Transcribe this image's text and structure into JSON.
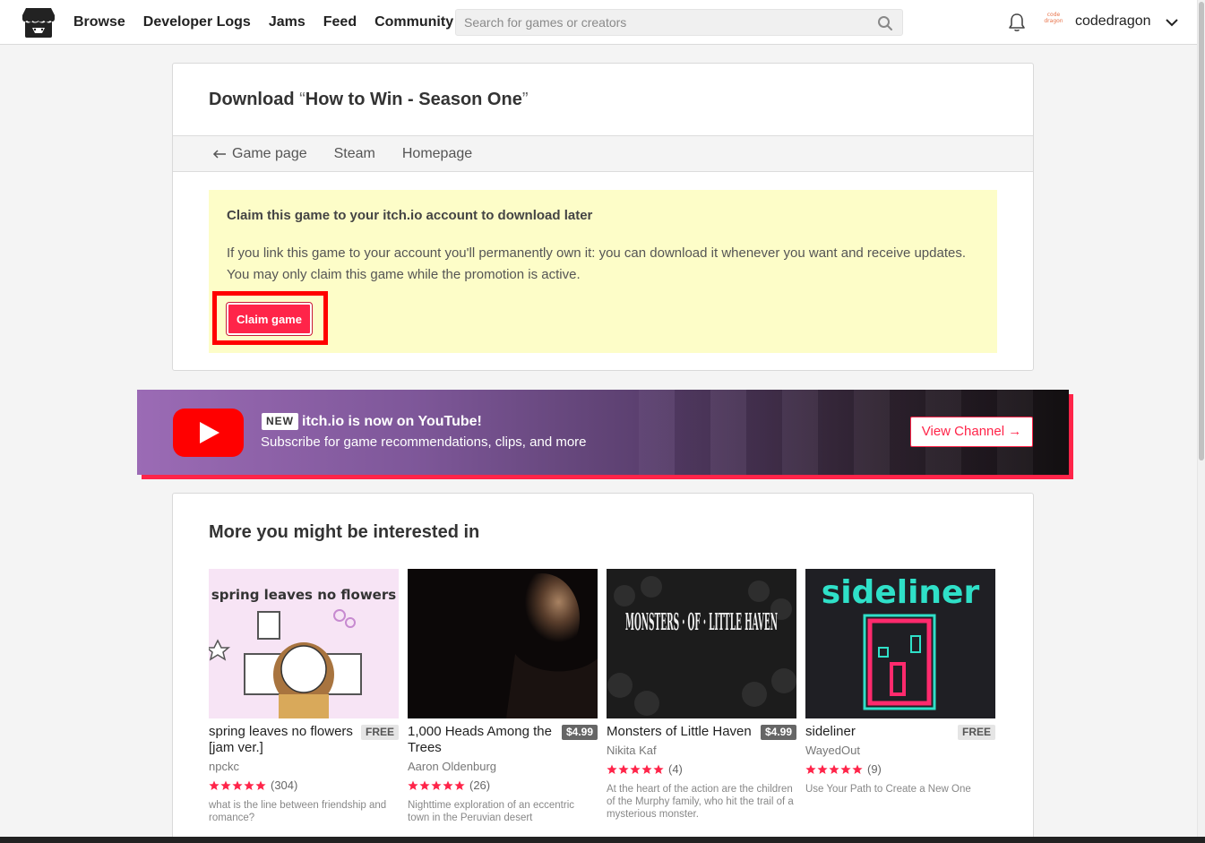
{
  "header": {
    "nav": [
      "Browse",
      "Developer Logs",
      "Jams",
      "Feed",
      "Community"
    ],
    "search_placeholder": "Search for games or creators",
    "username": "codedragon",
    "avatar_text": "code dragon"
  },
  "download": {
    "title_prefix": "Download ",
    "open_quote": "“",
    "game_title": "How to Win - Season One",
    "close_quote": "”",
    "subnav": [
      "Game page",
      "Steam",
      "Homepage"
    ],
    "claim_heading": "Claim this game to your itch.io account to download later",
    "claim_text": "If you link this game to your account you'll permanently own it: you can download it whenever you want and receive updates. You may only claim this game while the promotion is active.",
    "claim_button": "Claim game"
  },
  "youtube_banner": {
    "badge": "NEW",
    "headline": "itch.io is now on YouTube!",
    "subtitle": "Subscribe for game recommendations, clips, and more",
    "button": "View Channel →",
    "accent": "#ff2449"
  },
  "recommendations": {
    "title": "More you might be interested in",
    "games": [
      {
        "title": "spring leaves no flowers [jam ver.]",
        "price": "FREE",
        "author": "npckc",
        "stars": 5,
        "ratings": "(304)",
        "description": "what is the line between friendship and romance?",
        "thumb_text": "spring leaves no flowers"
      },
      {
        "title": "1,000 Heads Among the Trees",
        "price": "$4.99",
        "author": "Aaron Oldenburg",
        "stars": 5,
        "ratings": "(26)",
        "description": "Nighttime exploration of an eccentric town in the Peruvian desert",
        "thumb_text": ""
      },
      {
        "title": "Monsters of Little Haven",
        "price": "$4.99",
        "author": "Nikita Kaf",
        "stars": 5,
        "ratings": "(4)",
        "description": "At the heart of the action are the children of the Murphy family, who hit the trail of a mysterious monster.",
        "thumb_text": "MONSTERS · OF · LITTLE HAVEN"
      },
      {
        "title": "sideliner",
        "price": "FREE",
        "author": "WayedOut",
        "stars": 5,
        "ratings": "(9)",
        "description": "Use Your Path to Create a New One",
        "thumb_text": "sideliner"
      }
    ]
  }
}
